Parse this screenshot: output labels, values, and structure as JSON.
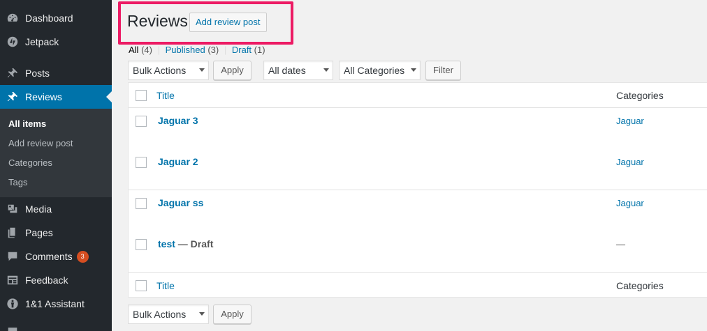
{
  "sidebar": {
    "items": [
      {
        "label": "Dashboard",
        "icon": "dashboard-icon"
      },
      {
        "label": "Jetpack",
        "icon": "jetpack-icon"
      },
      {
        "label": "Posts",
        "icon": "pin-icon"
      },
      {
        "label": "Reviews",
        "icon": "pin-icon",
        "current": true
      },
      {
        "label": "Media",
        "icon": "media-icon"
      },
      {
        "label": "Pages",
        "icon": "pages-icon"
      },
      {
        "label": "Comments",
        "icon": "comment-icon",
        "badge": "3"
      },
      {
        "label": "Feedback",
        "icon": "feedback-icon"
      },
      {
        "label": "1&1 Assistant",
        "icon": "assistant-icon"
      }
    ],
    "submenu": [
      {
        "label": "All items",
        "current": true
      },
      {
        "label": "Add review post"
      },
      {
        "label": "Categories"
      },
      {
        "label": "Tags"
      }
    ]
  },
  "header": {
    "title": "Reviews",
    "add_button": "Add review post"
  },
  "status_links": {
    "all": {
      "label": "All",
      "count": "(4)"
    },
    "published": {
      "label": "Published",
      "count": "(3)"
    },
    "draft": {
      "label": "Draft",
      "count": "(1)"
    },
    "separator": "|"
  },
  "filters": {
    "bulk_actions": "Bulk Actions",
    "apply": "Apply",
    "dates": "All dates",
    "categories": "All Categories",
    "filter": "Filter"
  },
  "table": {
    "columns": {
      "title": "Title",
      "categories": "Categories"
    },
    "rows": [
      {
        "title": "Jaguar 3",
        "state": "",
        "category": "Jaguar"
      },
      {
        "title": "Jaguar 2",
        "state": "",
        "category": "Jaguar"
      },
      {
        "title": "Jaguar ss",
        "state": "",
        "category": "Jaguar"
      },
      {
        "title": "test",
        "state": " — Draft",
        "category": "—"
      }
    ]
  },
  "colors": {
    "sidebar_bg": "#23282d",
    "active_menu": "#0073aa",
    "link": "#0073aa",
    "highlight_border": "#ec1b64",
    "badge": "#d54e21"
  }
}
